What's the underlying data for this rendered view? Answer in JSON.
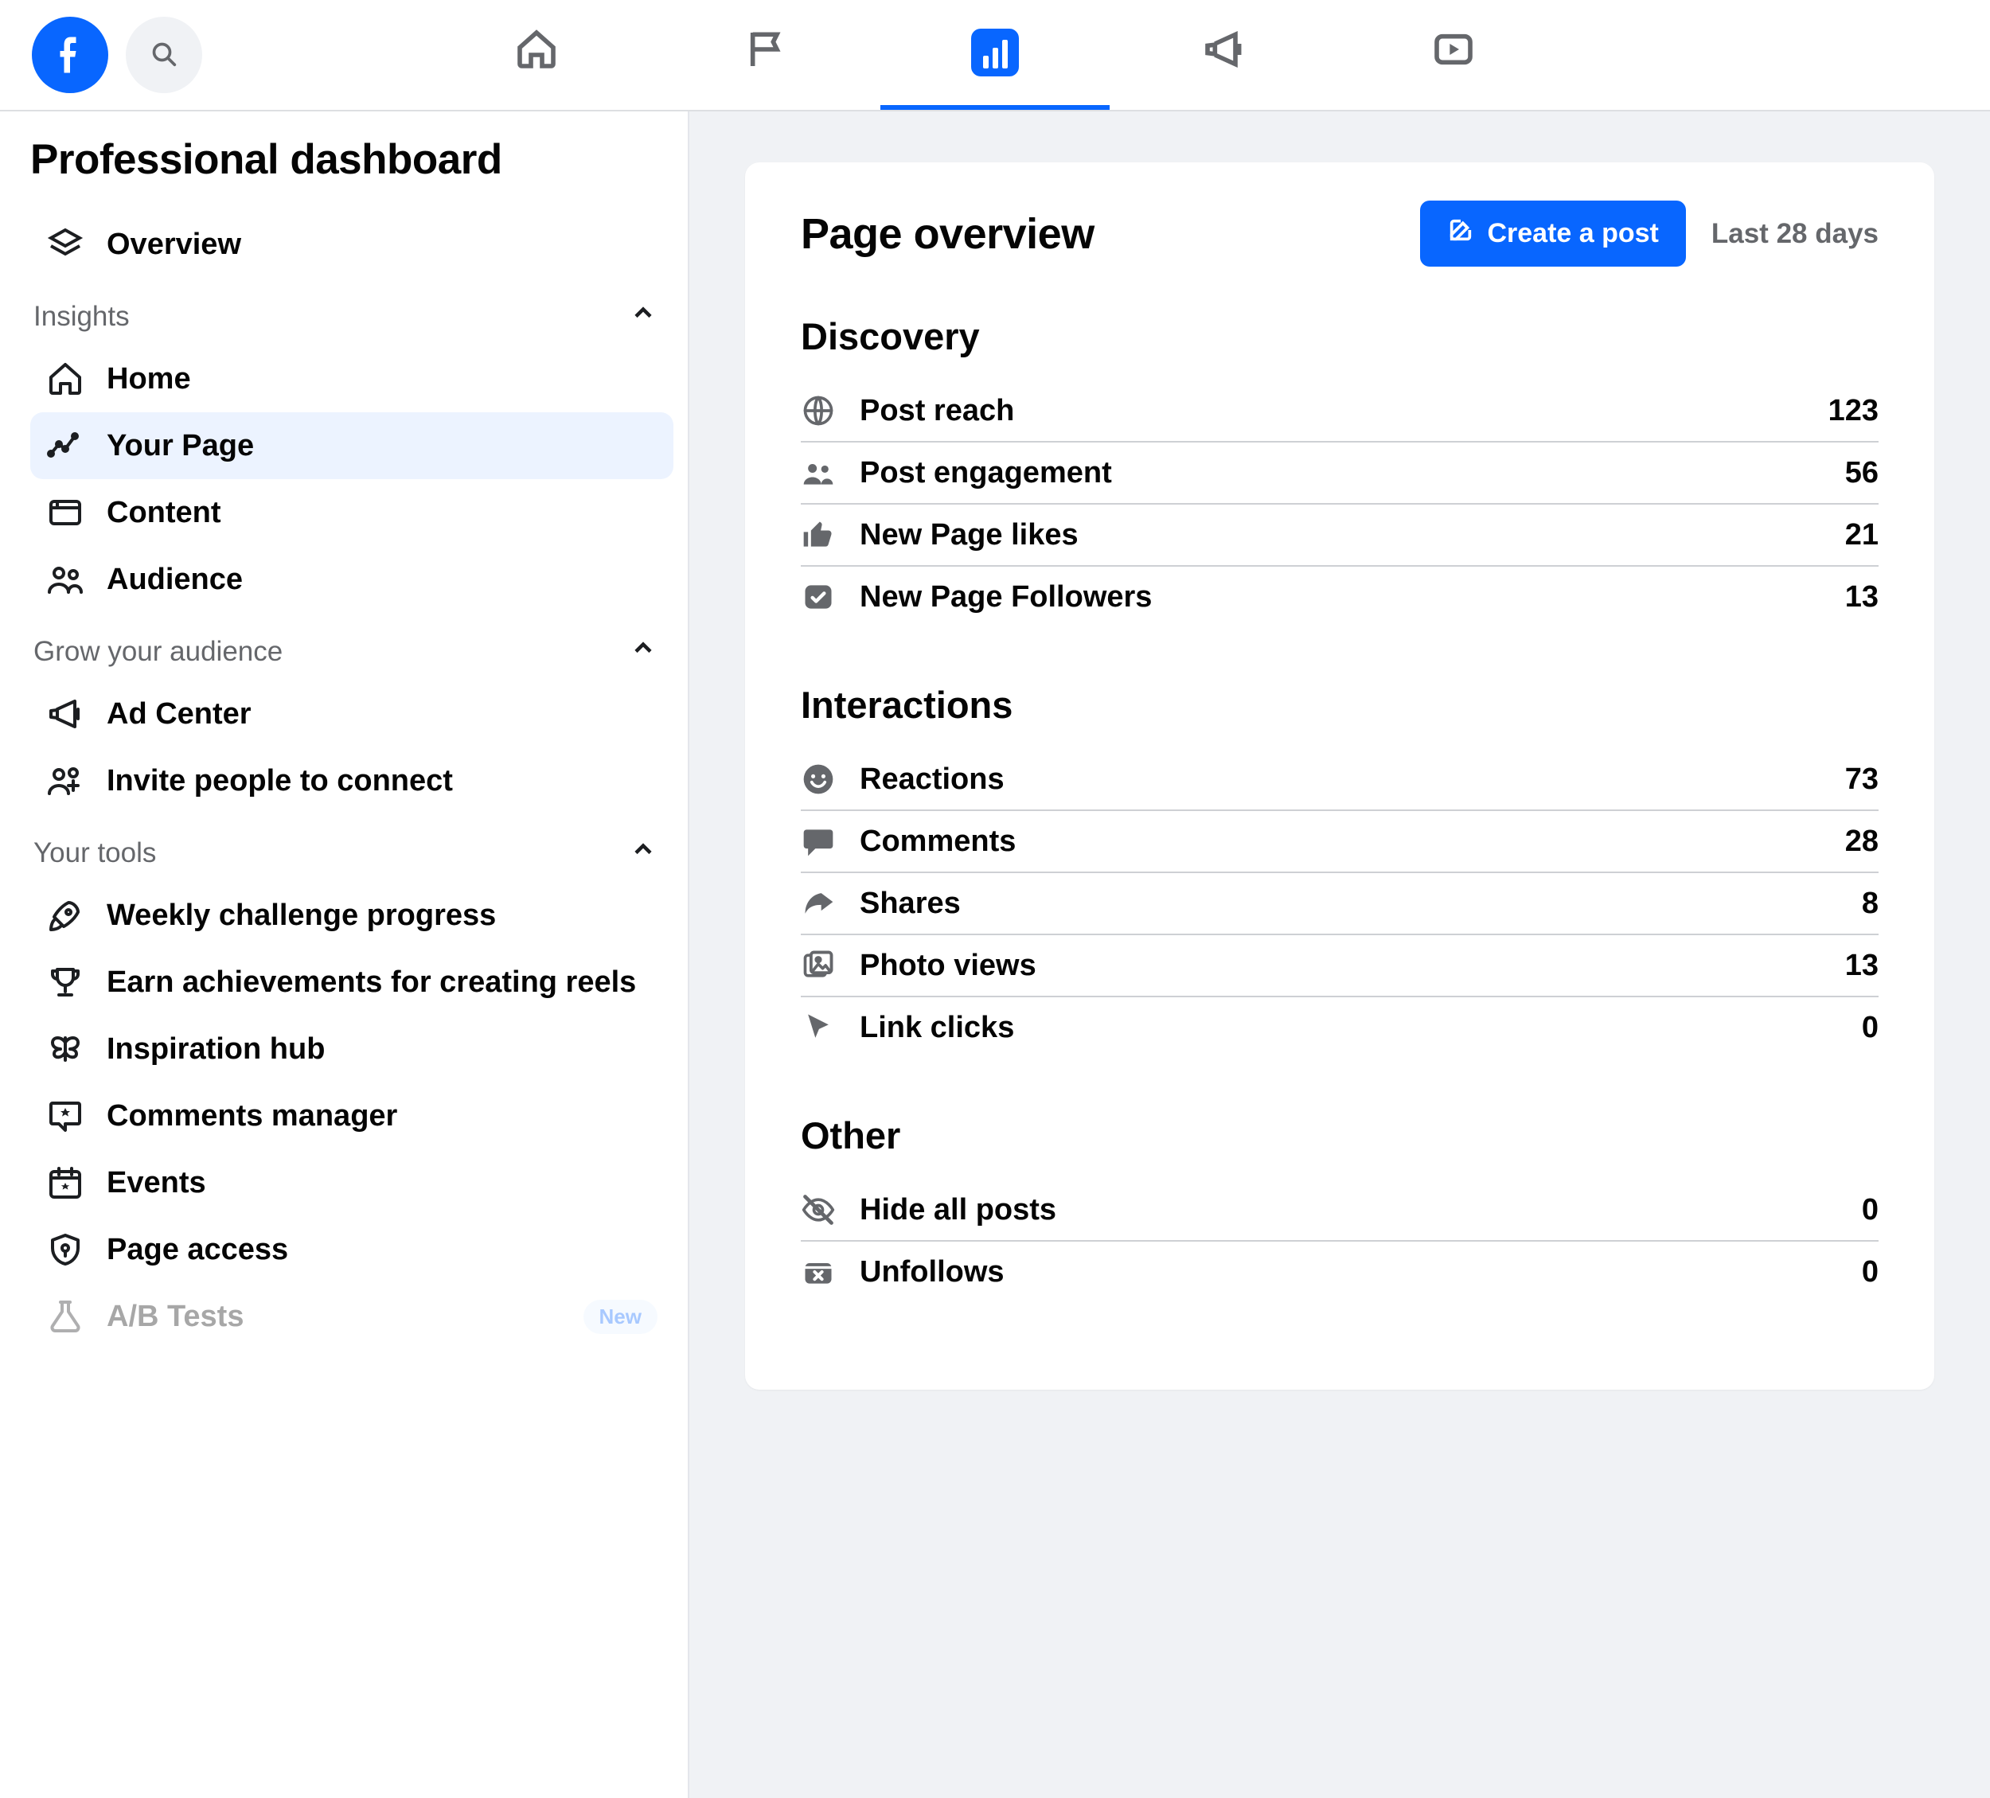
{
  "topnav": {
    "tabs": [
      "home",
      "flag",
      "insights",
      "megaphone",
      "video"
    ],
    "active_index": 2
  },
  "sidebar": {
    "title": "Professional dashboard",
    "overview_label": "Overview",
    "sections": [
      {
        "label": "Insights",
        "items": [
          {
            "icon": "house",
            "label": "Home"
          },
          {
            "icon": "chart-line",
            "label": "Your Page",
            "active": true
          },
          {
            "icon": "content",
            "label": "Content"
          },
          {
            "icon": "audience",
            "label": "Audience"
          }
        ]
      },
      {
        "label": "Grow your audience",
        "items": [
          {
            "icon": "megaphone",
            "label": "Ad Center"
          },
          {
            "icon": "invite",
            "label": "Invite people to connect"
          }
        ]
      },
      {
        "label": "Your tools",
        "items": [
          {
            "icon": "rocket",
            "label": "Weekly challenge progress"
          },
          {
            "icon": "trophy",
            "label": "Earn achievements for creating reels"
          },
          {
            "icon": "butterfly",
            "label": "Inspiration hub"
          },
          {
            "icon": "comment-star",
            "label": "Comments manager"
          },
          {
            "icon": "calendar-star",
            "label": "Events"
          },
          {
            "icon": "shield",
            "label": "Page access"
          },
          {
            "icon": "flask",
            "label": "A/B Tests",
            "faded": true,
            "badge": "New"
          }
        ]
      }
    ]
  },
  "main": {
    "page_overview_title": "Page overview",
    "create_post_label": "Create a post",
    "time_filter_label": "Last 28 days",
    "groups": [
      {
        "title": "Discovery",
        "metrics": [
          {
            "icon": "globe",
            "label": "Post reach",
            "value": "123"
          },
          {
            "icon": "people",
            "label": "Post engagement",
            "value": "56"
          },
          {
            "icon": "thumb",
            "label": "New Page likes",
            "value": "21"
          },
          {
            "icon": "follower-check",
            "label": "New Page Followers",
            "value": "13"
          }
        ]
      },
      {
        "title": "Interactions",
        "metrics": [
          {
            "icon": "smile",
            "label": "Reactions",
            "value": "73"
          },
          {
            "icon": "bubble",
            "label": "Comments",
            "value": "28"
          },
          {
            "icon": "share",
            "label": "Shares",
            "value": "8"
          },
          {
            "icon": "photo",
            "label": "Photo views",
            "value": "13"
          },
          {
            "icon": "cursor",
            "label": "Link clicks",
            "value": "0"
          }
        ]
      },
      {
        "title": "Other",
        "metrics": [
          {
            "icon": "eye-slash",
            "label": "Hide all posts",
            "value": "0"
          },
          {
            "icon": "box-x",
            "label": "Unfollows",
            "value": "0"
          }
        ]
      }
    ]
  }
}
